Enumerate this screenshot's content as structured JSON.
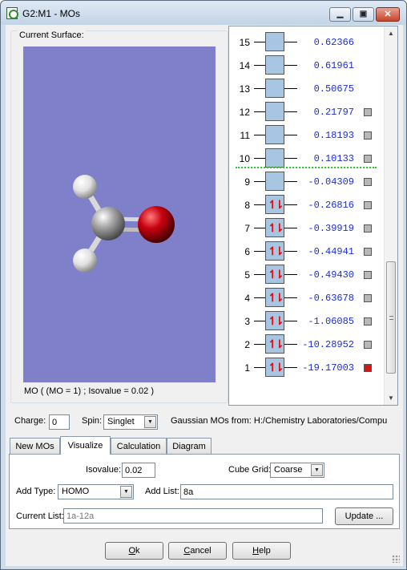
{
  "window": {
    "title": "G2:M1 - MOs"
  },
  "surface": {
    "group_label": "Current Surface:",
    "caption": "MO ( (MO = 1) ; Isovalue = 0.02 )",
    "atom_colors": {
      "carbon": "#8e8e8e",
      "oxygen": "#c4000a",
      "hydrogen": "#e6e6e6"
    }
  },
  "orbitals": [
    {
      "index": "15",
      "energy": "0.62366",
      "occupied": false,
      "checkbox": false,
      "selected": false
    },
    {
      "index": "14",
      "energy": "0.61961",
      "occupied": false,
      "checkbox": false,
      "selected": false
    },
    {
      "index": "13",
      "energy": "0.50675",
      "occupied": false,
      "checkbox": false,
      "selected": false
    },
    {
      "index": "12",
      "energy": "0.21797",
      "occupied": false,
      "checkbox": true,
      "selected": false
    },
    {
      "index": "11",
      "energy": "0.18193",
      "occupied": false,
      "checkbox": true,
      "selected": false
    },
    {
      "index": "10",
      "energy": "0.10133",
      "occupied": false,
      "checkbox": true,
      "selected": false
    },
    {
      "index": "9",
      "energy": "-0.04309",
      "occupied": false,
      "checkbox": true,
      "selected": false
    },
    {
      "index": "8",
      "energy": "-0.26816",
      "occupied": true,
      "checkbox": true,
      "selected": false
    },
    {
      "index": "7",
      "energy": "-0.39919",
      "occupied": true,
      "checkbox": true,
      "selected": false
    },
    {
      "index": "6",
      "energy": "-0.44941",
      "occupied": true,
      "checkbox": true,
      "selected": false
    },
    {
      "index": "5",
      "energy": "-0.49430",
      "occupied": true,
      "checkbox": true,
      "selected": false
    },
    {
      "index": "4",
      "energy": "-0.63678",
      "occupied": true,
      "checkbox": true,
      "selected": false
    },
    {
      "index": "3",
      "energy": "-1.06085",
      "occupied": true,
      "checkbox": true,
      "selected": false
    },
    {
      "index": "2",
      "energy": "-10.28952",
      "occupied": true,
      "checkbox": true,
      "selected": false
    },
    {
      "index": "1",
      "energy": "-19.17003",
      "occupied": true,
      "checkbox": true,
      "selected": true
    }
  ],
  "colors": {
    "energy_text": "#1a2ce0",
    "mo_box": "#a8c5e2",
    "electron_arrows": "#e01010",
    "homo_lumo_separator": "#2cc82c",
    "selected_check": "#d21515",
    "view_background": "#7f80c9"
  },
  "controls": {
    "charge_label": "Charge:",
    "charge_value": "0",
    "spin_label": "Spin:",
    "spin_value": "Singlet",
    "source_text": "Gaussian MOs from:  H:/Chemistry Laboratories/Compu"
  },
  "tabs": [
    {
      "label": "New MOs",
      "active": false
    },
    {
      "label": "Visualize",
      "active": true
    },
    {
      "label": "Calculation",
      "active": false
    },
    {
      "label": "Diagram",
      "active": false
    }
  ],
  "visualize": {
    "isovalue_label": "Isovalue:",
    "isovalue_value": "0.02",
    "cube_grid_label": "Cube Grid:",
    "cube_grid_value": "Coarse",
    "add_type_label": "Add Type:",
    "add_type_value": "HOMO",
    "add_list_label": "Add List:",
    "add_list_value": "8a",
    "current_list_label": "Current List:",
    "current_list_value": "1a-12a",
    "update_button": "Update ..."
  },
  "footer": {
    "ok": {
      "mnemonic": "O",
      "rest": "k"
    },
    "cancel": {
      "mnemonic": "C",
      "rest": "ancel"
    },
    "help": {
      "mnemonic": "H",
      "rest": "elp"
    }
  },
  "icons": {
    "app": "gaussview-document-icon",
    "minimize": "minimize-icon",
    "maximize": "maximize-icon",
    "close": "close-icon",
    "dropdown": "chevron-down-icon",
    "scroll_up": "chevron-up-icon",
    "scroll_down": "chevron-down-icon"
  }
}
